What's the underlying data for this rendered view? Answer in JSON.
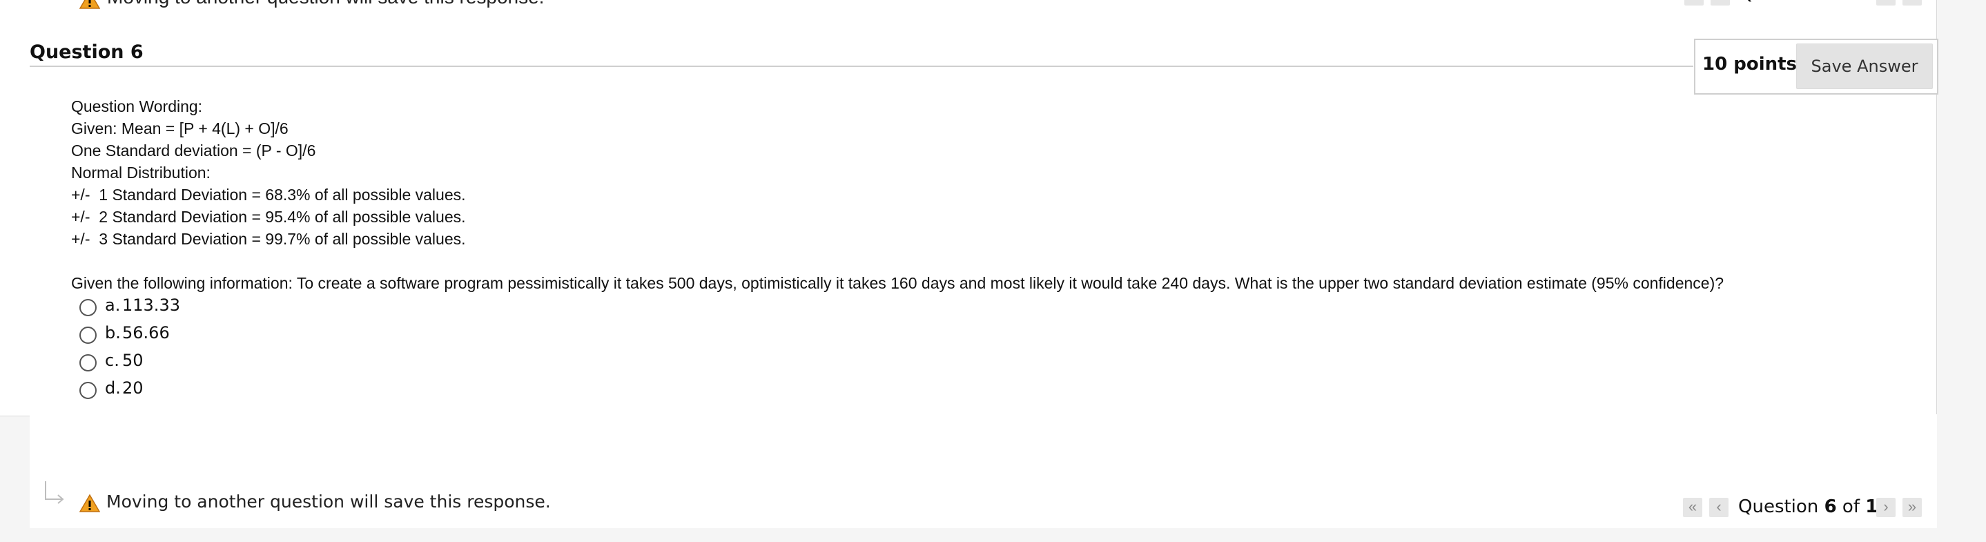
{
  "navigation": {
    "warning_text": "Moving to another question will save this response.",
    "status_prefix": "Question",
    "current": "6",
    "of_word": "of",
    "total": "10",
    "first_icon": "double-chevron-left-icon",
    "prev_icon": "chevron-left-icon",
    "next_icon": "chevron-right-icon",
    "last_icon": "double-chevron-right-icon"
  },
  "question": {
    "title": "Question 6",
    "points": "10 points",
    "save_label": "Save Answer",
    "lines": [
      "Question Wording:",
      "Given: Mean = [P + 4(L) + O]/6",
      "One Standard deviation = (P - O]/6",
      "Normal Distribution:",
      "+/-  1 Standard Deviation = 68.3% of all possible values.",
      "+/-  2 Standard Deviation = 95.4% of all possible values.",
      "+/-  3 Standard Deviation = 99.7% of all possible values."
    ],
    "prompt": "Given the following information: To create a software program pessimistically it takes 500 days, optimistically it takes 160 days and most likely it would take 240 days. What is the upper two standard deviation estimate (95% confidence)?",
    "answers": [
      {
        "letter": "a.",
        "text": "113.33",
        "selected": false
      },
      {
        "letter": "b.",
        "text": "56.66",
        "selected": false
      },
      {
        "letter": "c.",
        "text": "50",
        "selected": false
      },
      {
        "letter": "d.",
        "text": "20",
        "selected": false
      }
    ]
  },
  "colors": {
    "warning_orange": "#f0a020",
    "border_gray": "#cfcfcf",
    "button_gray": "#e3e3e3"
  }
}
